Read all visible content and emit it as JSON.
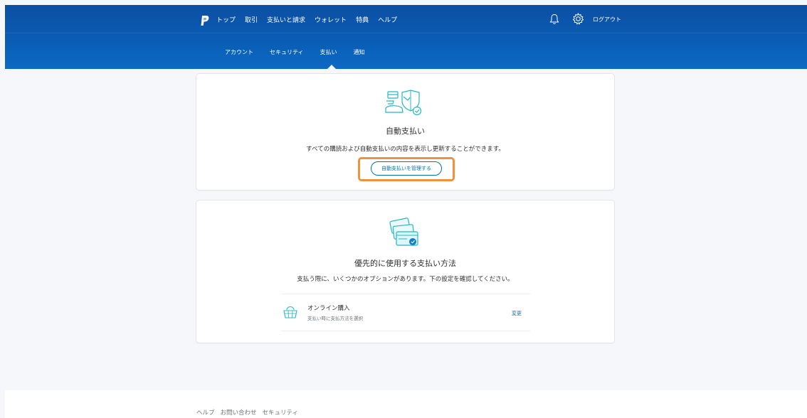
{
  "header": {
    "nav_primary": [
      "トップ",
      "取引",
      "支払いと請求",
      "ウォレット",
      "特典",
      "ヘルプ"
    ],
    "logout_label": "ログアウト",
    "nav_secondary": [
      "アカウント",
      "セキュリティ",
      "支払い",
      "通知"
    ]
  },
  "autopay_card": {
    "title": "自動支払い",
    "description": "すべての購読および自動支払いの内容を表示し更新することができます。",
    "button_label": "自動支払いを管理する"
  },
  "preferred_card": {
    "title": "優先的に使用する支払い方法",
    "description": "支払う際に、いくつかのオプションがあります。下の設定を確認してください。",
    "option_title": "オンライン購入",
    "option_subtitle": "支払い時に支払方法を選択",
    "change_label": "変更"
  },
  "footer": {
    "links": [
      "ヘルプ",
      "お問い合わせ",
      "セキュリティ"
    ]
  },
  "colors": {
    "header_blue": "#0a5eb6",
    "link_blue": "#0070ba",
    "highlight_orange": "#f1913c",
    "icon_teal": "#24b7c2"
  },
  "icons": {
    "logo": "paypal-logo",
    "bell": "bell-icon",
    "gear": "gear-icon",
    "autopay": "autopay-shield-icon",
    "cards": "payment-cards-icon",
    "basket": "shopping-basket-icon"
  }
}
